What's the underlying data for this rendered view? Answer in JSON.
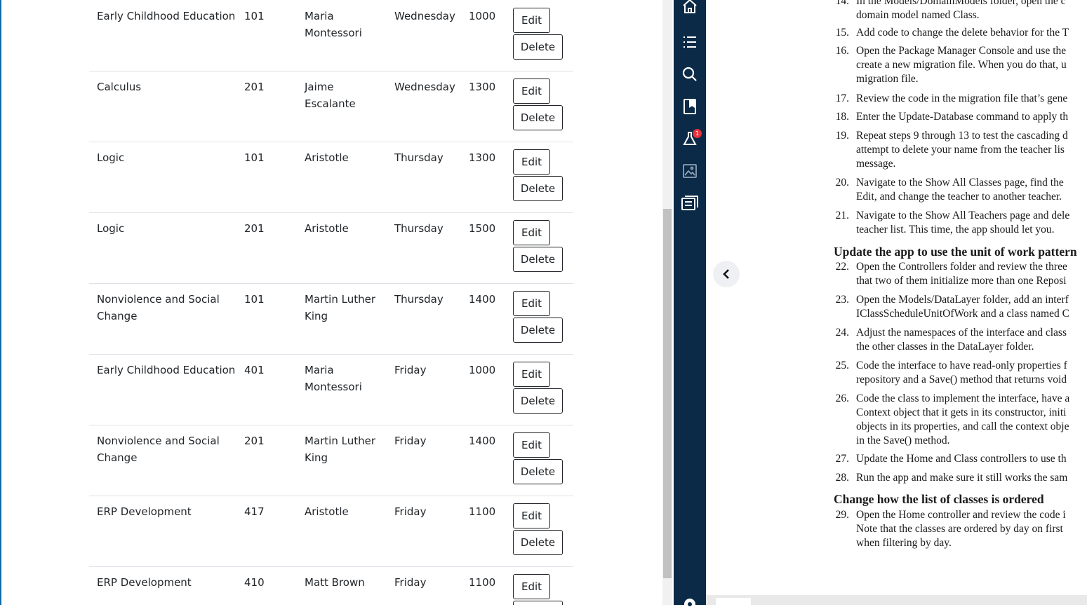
{
  "table": {
    "buttons": {
      "edit": "Edit",
      "delete": "Delete"
    },
    "rows": [
      {
        "name_lines": [
          "Early Childhood Education"
        ],
        "number": "101",
        "teacher_lines": [
          "Maria",
          "Montessori"
        ],
        "day": "Wednesday",
        "time": "1000"
      },
      {
        "name_lines": [
          "Calculus"
        ],
        "number": "201",
        "teacher_lines": [
          "Jaime",
          "Escalante"
        ],
        "day": "Wednesday",
        "time": "1300"
      },
      {
        "name_lines": [
          "Logic"
        ],
        "number": "101",
        "teacher_lines": [
          "Aristotle"
        ],
        "day": "Thursday",
        "time": "1300"
      },
      {
        "name_lines": [
          "Logic"
        ],
        "number": "201",
        "teacher_lines": [
          "Aristotle"
        ],
        "day": "Thursday",
        "time": "1500"
      },
      {
        "name_lines": [
          "Nonviolence and Social",
          "Change"
        ],
        "number": "101",
        "teacher_lines": [
          "Martin Luther",
          "King"
        ],
        "day": "Thursday",
        "time": "1400"
      },
      {
        "name_lines": [
          "Early Childhood Education"
        ],
        "number": "401",
        "teacher_lines": [
          "Maria",
          "Montessori"
        ],
        "day": "Friday",
        "time": "1000"
      },
      {
        "name_lines": [
          "Nonviolence and Social",
          "Change"
        ],
        "number": "201",
        "teacher_lines": [
          "Martin Luther",
          "King"
        ],
        "day": "Friday",
        "time": "1400"
      },
      {
        "name_lines": [
          "ERP Development"
        ],
        "number": "417",
        "teacher_lines": [
          "Aristotle"
        ],
        "day": "Friday",
        "time": "1100"
      },
      {
        "name_lines": [
          "ERP Development"
        ],
        "number": "410",
        "teacher_lines": [
          "Matt Brown"
        ],
        "day": "Friday",
        "time": "1100"
      }
    ]
  },
  "sidebar": {
    "icons": [
      "home-icon",
      "table-of-contents-icon",
      "search-icon",
      "bookmark-icon",
      "lab-icon",
      "image-icon",
      "notes-icon",
      "settings-icon"
    ],
    "lab_badge": "1",
    "color": "#0b2a47"
  },
  "reader": {
    "back_icon": "chevron-left-icon",
    "steps": [
      {
        "n": "14.",
        "lines": [
          "In the Models/DomainModels folder, open the c",
          "domain model named Class."
        ]
      },
      {
        "n": "15.",
        "lines": [
          "Add code to change the delete behavior for the T"
        ]
      },
      {
        "n": "16.",
        "lines": [
          "Open the Package Manager Console and use the",
          "create a new migration file. When you do that, u",
          "migration file."
        ]
      },
      {
        "n": "17.",
        "lines": [
          "Review the code in the migration file that’s gene"
        ]
      },
      {
        "n": "18.",
        "lines": [
          "Enter the Update-Database command to apply th"
        ]
      },
      {
        "n": "19.",
        "lines": [
          "Repeat steps 9 through 13 to test the cascading d",
          "attempt to delete your name from the teacher lis",
          "message."
        ]
      },
      {
        "n": "20.",
        "lines": [
          "Navigate to the Show All Classes page, find the",
          "Edit, and change the teacher to another teacher."
        ]
      },
      {
        "n": "21.",
        "lines": [
          "Navigate to the Show All Teachers page and dele",
          "teacher list. This time, the app should let you."
        ]
      },
      {
        "n": "22.",
        "lines": [
          "Open the Controllers folder and review the three",
          "that two of them initialize more than one Reposi"
        ]
      },
      {
        "n": "23.",
        "lines": [
          "Open the Models/DataLayer folder, add an interf",
          "IClassScheduleUnitOfWork and a class named C"
        ]
      },
      {
        "n": "24.",
        "lines": [
          "Adjust the namespaces of the interface and class",
          "the other classes in the DataLayer folder."
        ]
      },
      {
        "n": "25.",
        "lines": [
          "Code the interface to have read-only properties f",
          "repository and a Save() method that returns void"
        ]
      },
      {
        "n": "26.",
        "lines": [
          "Code the class to implement the interface, have a",
          "Context object that it gets in its constructor, initi",
          "objects in its properties, and call the context obje",
          "in the Save() method."
        ]
      },
      {
        "n": "27.",
        "lines": [
          "Update the Home and Class controllers to use th"
        ]
      },
      {
        "n": "28.",
        "lines": [
          "Run the app and make sure it still works the sam"
        ]
      },
      {
        "n": "29.",
        "lines": [
          "Open the Home controller and review the code i",
          "Note that the classes are ordered by day on first",
          "when filtering by day."
        ]
      }
    ],
    "headings": {
      "unit_of_work": "Update the app to use the unit of work pattern",
      "ordering": "Change how the list of classes is ordered"
    }
  }
}
